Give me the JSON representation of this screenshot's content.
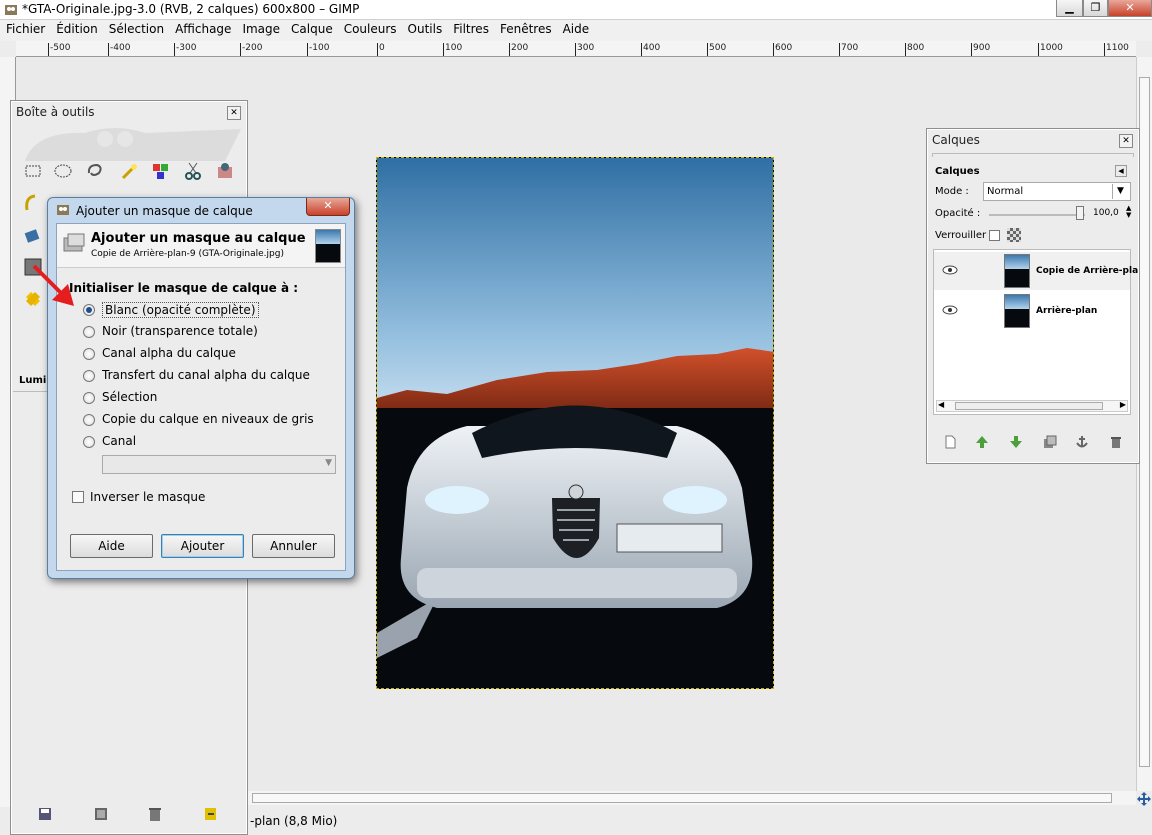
{
  "window": {
    "title": "*GTA-Originale.jpg-3.0 (RVB, 2 calques) 600x800 – GIMP",
    "minimize": "▁",
    "maximize": "❐",
    "close": "✕"
  },
  "menu": [
    "Fichier",
    "Édition",
    "Sélection",
    "Affichage",
    "Image",
    "Calque",
    "Couleurs",
    "Outils",
    "Filtres",
    "Fenêtres",
    "Aide"
  ],
  "ruler": {
    "ticks": [
      "-500",
      "-400",
      "-300",
      "-200",
      "-100",
      "0",
      "100",
      "200",
      "300",
      "400",
      "500",
      "600",
      "700",
      "800",
      "900",
      "1000",
      "1100"
    ]
  },
  "toolbox": {
    "title": "Boîte à outils",
    "partial_label": "Lumin"
  },
  "status": {
    "text": "-plan (8,8 Mio)"
  },
  "dialog": {
    "window_title": "Ajouter un masque de calque",
    "heading": "Ajouter un masque au calque",
    "subheading": "Copie de Arrière-plan-9 (GTA-Originale.jpg)",
    "section_label": "Initialiser le masque de calque à :",
    "options": [
      {
        "label": "Blanc (opacité complète)",
        "selected": true
      },
      {
        "label": "Noir (transparence totale)",
        "selected": false
      },
      {
        "label": "Canal alpha du calque",
        "selected": false
      },
      {
        "label": "Transfert du canal alpha du calque",
        "selected": false
      },
      {
        "label": "Sélection",
        "selected": false
      },
      {
        "label": "Copie du calque en niveaux de gris",
        "selected": false
      },
      {
        "label": "Canal",
        "selected": false
      }
    ],
    "invert_label": "Inverser le masque",
    "buttons": {
      "help": "Aide",
      "add": "Ajouter",
      "cancel": "Annuler"
    }
  },
  "layers": {
    "title": "Calques",
    "tab_label": "Calques",
    "mode_label": "Mode :",
    "mode_value": "Normal",
    "opacity_label": "Opacité :",
    "opacity_value": "100,0",
    "lock_label": "Verrouiller :",
    "items": [
      {
        "name": "Copie de Arrière-pla"
      },
      {
        "name": "Arrière-plan"
      }
    ]
  },
  "colors": {
    "accent": "#1a4f93",
    "arrow": "#e41e1e",
    "selection": "#c9b300"
  }
}
